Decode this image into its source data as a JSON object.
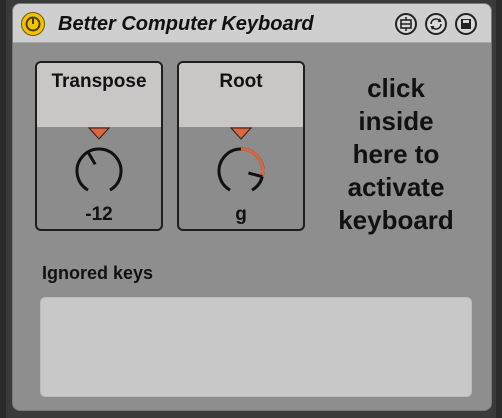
{
  "device": {
    "title": "Better Computer Keyboard",
    "power_icon": "power-icon",
    "header_buttons": [
      "midi-map-icon",
      "reload-icon",
      "save-icon"
    ]
  },
  "transpose": {
    "label": "Transpose",
    "value": "-12",
    "knob_fraction": 0.4
  },
  "root": {
    "label": "Root",
    "value": "g",
    "knob_fraction": 0.85
  },
  "click_message": [
    "click",
    "inside",
    "here to",
    "activate",
    "keyboard"
  ],
  "ignored_keys": {
    "label": "Ignored keys",
    "value": ""
  },
  "colors": {
    "accent": "#e0643c",
    "power": "#f3c300",
    "panel_head": "#c9c6c6",
    "body": "#8e8e8e"
  }
}
